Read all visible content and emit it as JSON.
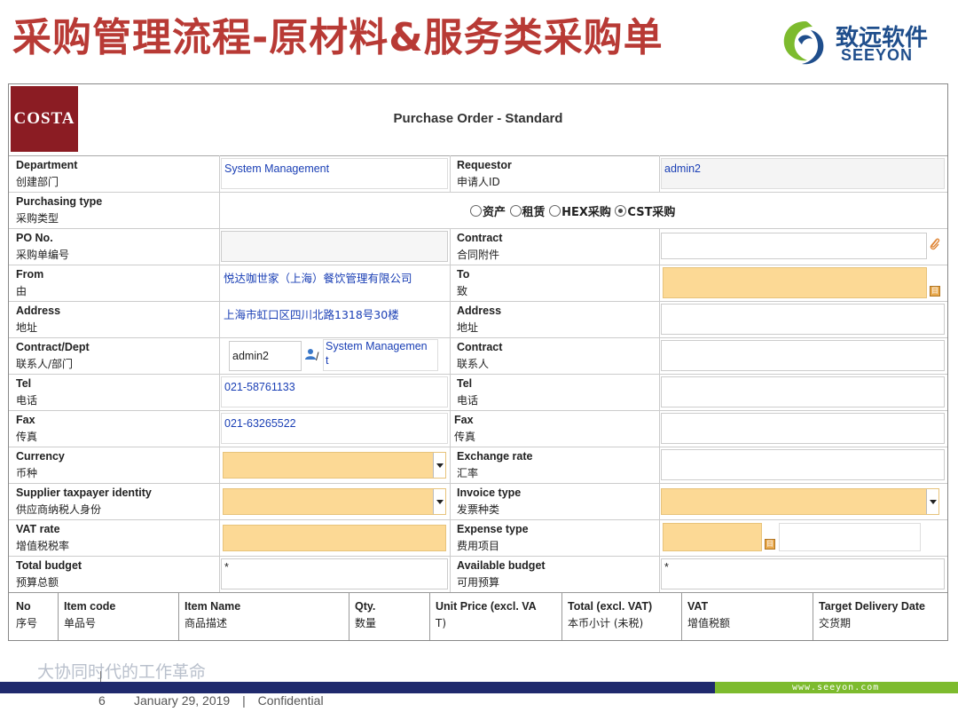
{
  "slide": {
    "title": "采购管理流程-原材料&服务类采购单",
    "brand_cn": "致远软件",
    "brand_en": "SEEYON",
    "brand_colors": [
      "#1f4e8c",
      "#7dbb2e"
    ]
  },
  "form": {
    "logo_text": "COSTA",
    "title": "Purchase Order - Standard",
    "department": {
      "en": "Department",
      "cn": "创建部门",
      "value": "System Management"
    },
    "requestor": {
      "en": "Requestor",
      "cn": "申请人ID",
      "value": "admin2"
    },
    "purchasing_type": {
      "en": "Purchasing type",
      "cn": "采购类型",
      "options": [
        "资产",
        "租赁",
        "HEX采购",
        "CST采购"
      ],
      "selected": "CST采购"
    },
    "po_no": {
      "en": "PO No.",
      "cn": "采购单编号",
      "value": ""
    },
    "contract_attach": {
      "en": "Contract",
      "cn": "合同附件",
      "value": ""
    },
    "from": {
      "en": "From",
      "cn": "由",
      "value": "悦达咖世家（上海）餐饮管理有限公司"
    },
    "to": {
      "en": "To",
      "cn": "致",
      "value": ""
    },
    "address_from": {
      "en": "Address",
      "cn": "地址",
      "value": "上海市虹口区四川北路1318号30楼"
    },
    "address_to": {
      "en": "Address",
      "cn": "地址",
      "value": ""
    },
    "contact_dept": {
      "en": "Contract/Dept",
      "cn": "联系人/部门",
      "contact": "admin2",
      "sep": "/",
      "dept_line1": "System Managemen",
      "dept_line2": "t"
    },
    "contact_to": {
      "en": "Contract",
      "cn": "联系人",
      "value": ""
    },
    "tel_from": {
      "en": "Tel",
      "cn": "电话",
      "value": "021-58761133"
    },
    "tel_to": {
      "en": "Tel",
      "cn": "电话",
      "value": ""
    },
    "fax_from": {
      "en": "Fax",
      "cn": "传真",
      "value": "021-63265522"
    },
    "fax_to": {
      "en": "Fax",
      "cn": "传真",
      "value": ""
    },
    "currency": {
      "en": "Currency",
      "cn": "币种",
      "value": ""
    },
    "exchange_rate": {
      "en": "Exchange rate",
      "cn": "汇率",
      "value": ""
    },
    "supplier_taxpayer": {
      "en": "Supplier taxpayer identity",
      "cn": "供应商纳税人身份",
      "value": ""
    },
    "invoice_type": {
      "en": "Invoice type",
      "cn": "发票种类",
      "value": ""
    },
    "vat_rate": {
      "en": "VAT rate",
      "cn": "增值税税率",
      "value": ""
    },
    "expense_type": {
      "en": "Expense type",
      "cn": "费用项目",
      "value": ""
    },
    "total_budget": {
      "en": "Total budget",
      "cn": "预算总额",
      "value": "*"
    },
    "available_budget": {
      "en": "Available budget",
      "cn": "可用预算",
      "value": "*"
    },
    "item_columns": [
      {
        "en": "No",
        "cn": "序号"
      },
      {
        "en": "Item code",
        "cn": "单品号"
      },
      {
        "en": "Item Name",
        "cn": "商品描述"
      },
      {
        "en": "Qty.",
        "cn": "数量"
      },
      {
        "en": "Unit Price (excl. VA",
        "cn": "T)"
      },
      {
        "en": "Total (excl. VAT)",
        "cn": "本币小计 (未税)"
      },
      {
        "en": "VAT",
        "cn": "增值税额"
      },
      {
        "en": "Target Delivery Date",
        "cn": "交货期"
      }
    ]
  },
  "footer": {
    "slogan": "大协同时代的工作革命",
    "url": "www.seeyon.com",
    "page": "6",
    "date": "January 29, 2019",
    "separator": "|",
    "label": "Confidential"
  }
}
